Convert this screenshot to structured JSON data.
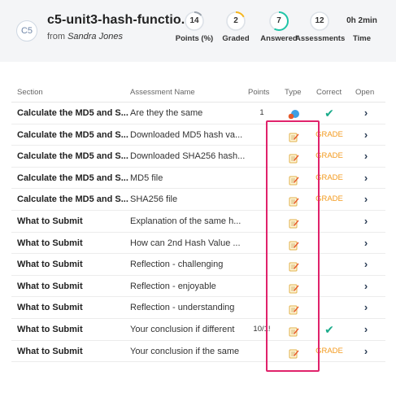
{
  "header": {
    "avatar": "C5",
    "title": "c5-unit3-hash-functio...",
    "from_label": "from",
    "author": "Sandra Jones",
    "stats": [
      {
        "value": "14",
        "label": "Points (%)",
        "color": "#9aa3ad",
        "fill": 0.14
      },
      {
        "value": "2",
        "label": "Graded",
        "color": "#f5b51c",
        "fill": 0.17
      },
      {
        "value": "7",
        "label": "Answered",
        "color": "#1fc5a7",
        "fill": 0.58
      },
      {
        "value": "12",
        "label": "Assessments",
        "color": "#cfd6de",
        "fill": 0
      },
      {
        "value": "0h 2min",
        "label": "Time"
      }
    ]
  },
  "table": {
    "headers": {
      "section": "Section",
      "name": "Assessment Name",
      "points": "Points",
      "type": "Type",
      "correct": "Correct",
      "open": "Open"
    },
    "rows": [
      {
        "section": "Calculate the MD5 and S...",
        "name": "Are they the same",
        "points": "1",
        "type": "multiple-choice-icon",
        "correct": "check"
      },
      {
        "section": "Calculate the MD5 and S...",
        "name": "Downloaded MD5 hash va...",
        "points": "",
        "type": "free-text-icon",
        "correct": "GRADE"
      },
      {
        "section": "Calculate the MD5 and S...",
        "name": "Downloaded SHA256 hash...",
        "points": "",
        "type": "free-text-icon",
        "correct": "GRADE"
      },
      {
        "section": "Calculate the MD5 and S...",
        "name": "MD5 file",
        "points": "",
        "type": "free-text-icon",
        "correct": "GRADE"
      },
      {
        "section": "Calculate the MD5 and S...",
        "name": "SHA256 file",
        "points": "",
        "type": "free-text-icon",
        "correct": "GRADE"
      },
      {
        "section": "What to Submit",
        "name": "Explanation of the same h...",
        "points": "",
        "type": "free-text-icon",
        "correct": ""
      },
      {
        "section": "What to Submit",
        "name": "How can 2nd Hash Value ...",
        "points": "",
        "type": "free-text-icon",
        "correct": ""
      },
      {
        "section": "What to Submit",
        "name": "Reflection - challenging",
        "points": "",
        "type": "free-text-icon",
        "correct": ""
      },
      {
        "section": "What to Submit",
        "name": "Reflection - enjoyable",
        "points": "",
        "type": "free-text-icon",
        "correct": ""
      },
      {
        "section": "What to Submit",
        "name": "Reflection - understanding",
        "points": "",
        "type": "free-text-icon",
        "correct": ""
      },
      {
        "section": "What to Submit",
        "name": "Your conclusion if different",
        "points": "10/1!",
        "type": "free-text-icon",
        "correct": "check"
      },
      {
        "section": "What to Submit",
        "name": "Your conclusion if the same",
        "points": "",
        "type": "free-text-icon",
        "correct": "GRADE"
      }
    ],
    "open_glyph": "›"
  },
  "colors": {
    "grade": "#f39a1e",
    "check": "#1aab8a",
    "highlight": "#e0226b"
  }
}
